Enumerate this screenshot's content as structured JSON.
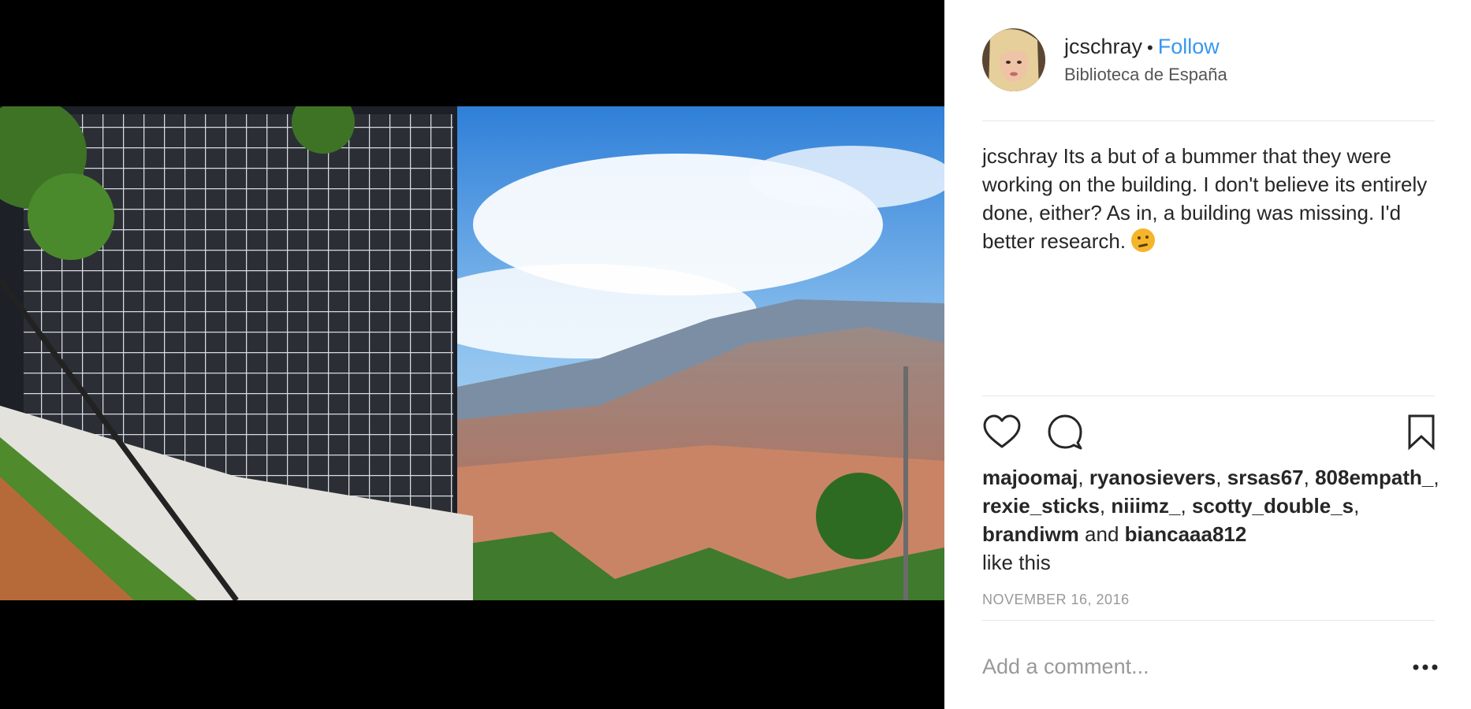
{
  "post": {
    "username": "jcschray",
    "separator": "•",
    "follow_label": "Follow",
    "location": "Biblioteca de España"
  },
  "caption": {
    "username": "jcschray",
    "text": "Its a but of a bummer that they were working on the building. I don't believe its entirely done, either? As in, a building was missing. I'd better research."
  },
  "likes": {
    "names": [
      "majoomaj",
      "ryanosievers",
      "srsas67",
      "808empath_",
      "rexie_sticks",
      "niiimz_",
      "scotty_double_s",
      "brandiwm"
    ],
    "and_label": "and",
    "last_name": "biancaaa812",
    "suffix": "like this"
  },
  "date": "NOVEMBER 16, 2016",
  "comment": {
    "placeholder": "Add a comment..."
  },
  "icons": {
    "like": "heart-icon",
    "comment": "comment-bubble-icon",
    "save": "bookmark-icon",
    "more": "more-options-icon"
  }
}
